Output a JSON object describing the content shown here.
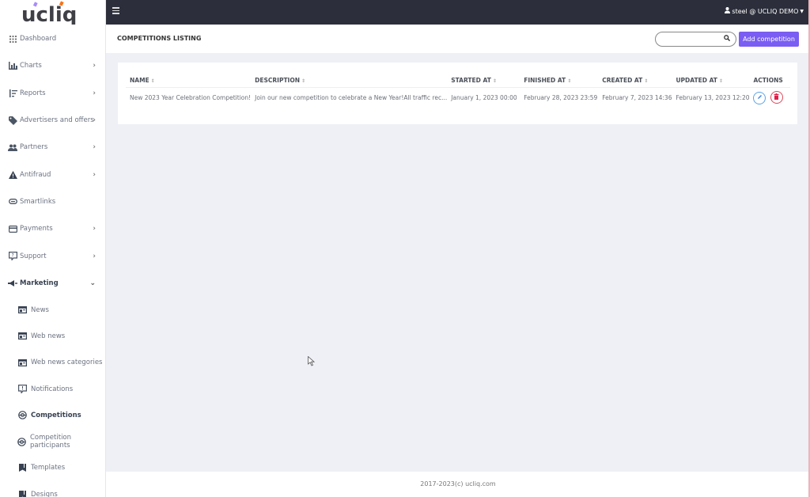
{
  "app": {
    "brand": "ucliq"
  },
  "topbar": {
    "user_label": "steel @ UCLIQ DEMO"
  },
  "sidebar": {
    "items": [
      {
        "label": "Dashboard",
        "icon": "grid-icon",
        "has_chevron": false
      },
      {
        "label": "Charts",
        "icon": "bar-chart-icon",
        "has_chevron": true
      },
      {
        "label": "Reports",
        "icon": "sort-list-icon",
        "has_chevron": true
      },
      {
        "label": "Advertisers and offers",
        "icon": "tag-icon",
        "has_chevron": true
      },
      {
        "label": "Partners",
        "icon": "users-icon",
        "has_chevron": true
      },
      {
        "label": "Antifraud",
        "icon": "warning-icon",
        "has_chevron": true
      },
      {
        "label": "Smartlinks",
        "icon": "link-icon",
        "has_chevron": false
      },
      {
        "label": "Payments",
        "icon": "credit-card-icon",
        "has_chevron": true
      },
      {
        "label": "Support",
        "icon": "help-box-icon",
        "has_chevron": true
      },
      {
        "label": "Marketing",
        "icon": "megaphone-icon",
        "has_chevron": true,
        "expanded": true
      }
    ],
    "sub_items": [
      {
        "label": "News",
        "icon": "newspaper-icon"
      },
      {
        "label": "Web news",
        "icon": "newspaper-icon"
      },
      {
        "label": "Web news categories",
        "icon": "newspaper-icon"
      },
      {
        "label": "Notifications",
        "icon": "alert-box-icon"
      },
      {
        "label": "Competitions",
        "icon": "target-icon",
        "active": true
      },
      {
        "label": "Competition participants",
        "icon": "target-icon"
      },
      {
        "label": "Templates",
        "icon": "bookmark-icon"
      },
      {
        "label": "Designs",
        "icon": "bookmark-icon"
      }
    ]
  },
  "page": {
    "title": "COMPETITIONS LISTING",
    "search": {
      "value": "",
      "placeholder": ""
    },
    "add_button": "Add competition"
  },
  "table": {
    "columns": [
      "NAME",
      "DESCRIPTION",
      "STARTED AT",
      "FINISHED AT",
      "CREATED AT",
      "UPDATED AT",
      "ACTIONS"
    ],
    "rows": [
      {
        "name": "New 2023 Year Celebration Competition!",
        "description": "Join our new competition to celebrate a New Year!All traffic rec...",
        "started_at": "January 1, 2023 00:00",
        "finished_at": "February 28, 2023 23:59",
        "created_at": "February 7, 2023 14:36",
        "updated_at": "February 13, 2023 12:20"
      }
    ]
  },
  "footer": {
    "text": "2017-2023(c) ucliq.com"
  },
  "colors": {
    "accent": "#7a5df2",
    "topbar": "#2c2f3b",
    "edit": "#3b82f6",
    "delete": "#e11d48"
  }
}
